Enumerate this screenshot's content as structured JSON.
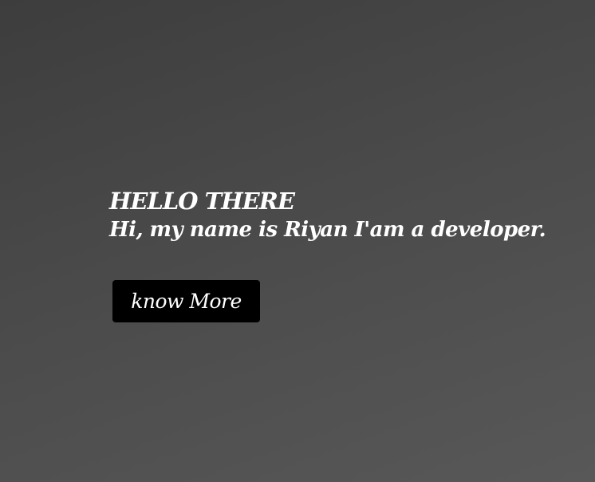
{
  "hero": {
    "greeting": "HELLO THERE",
    "intro": "Hi, my name is Riyan I'am a developer.",
    "cta_label": "know More"
  },
  "colors": {
    "background_top": "#3d3d3d",
    "background_bottom": "#585858",
    "text": "#ffffff",
    "button_bg": "#000000"
  }
}
